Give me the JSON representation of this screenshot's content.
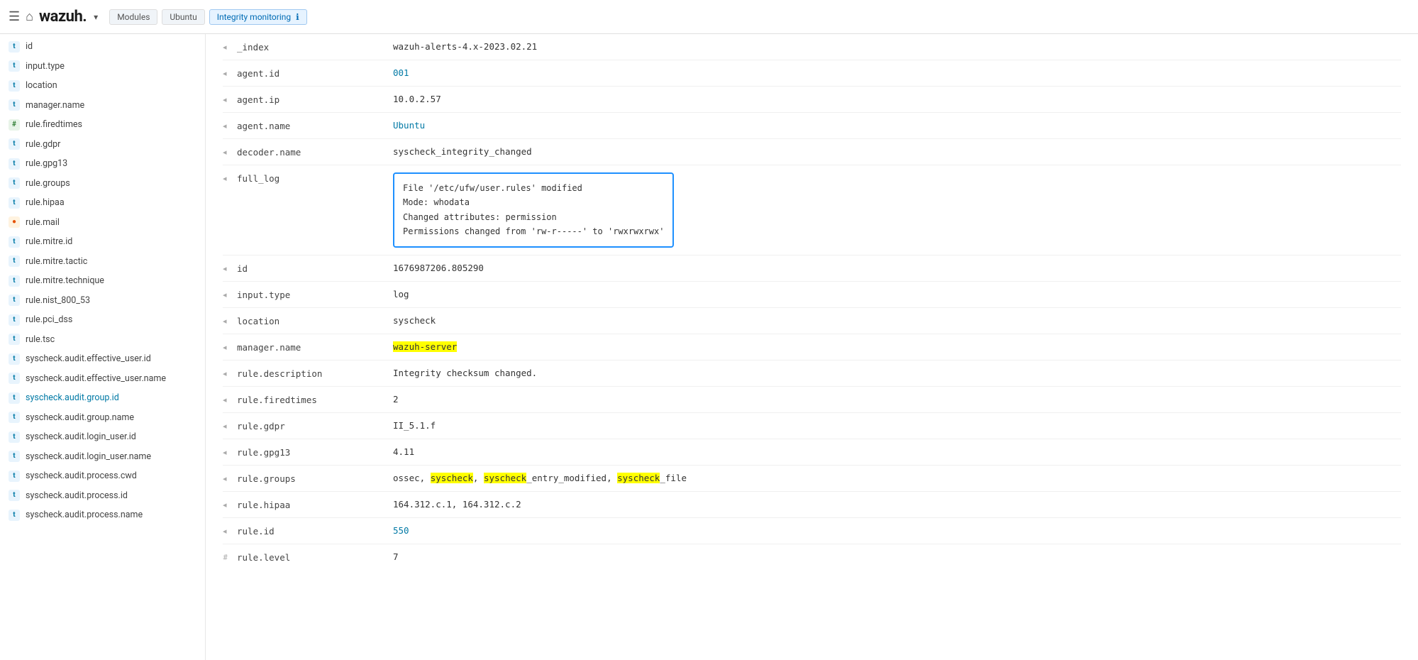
{
  "nav": {
    "hamburger": "☰",
    "home": "⌂",
    "logo_text": "wazuh.",
    "dropdown_arrow": "▾",
    "breadcrumbs": [
      {
        "label": "Modules",
        "active": false
      },
      {
        "label": "Ubuntu",
        "active": false
      },
      {
        "label": "Integrity monitoring",
        "active": true
      }
    ],
    "info_icon": "ℹ"
  },
  "sidebar": {
    "items": [
      {
        "type": "t",
        "label": "id"
      },
      {
        "type": "t",
        "label": "input.type"
      },
      {
        "type": "t",
        "label": "location"
      },
      {
        "type": "t",
        "label": "manager.name"
      },
      {
        "type": "hash",
        "label": "rule.firedtimes"
      },
      {
        "type": "t",
        "label": "rule.gdpr"
      },
      {
        "type": "t",
        "label": "rule.gpg13"
      },
      {
        "type": "t",
        "label": "rule.groups"
      },
      {
        "type": "t",
        "label": "rule.hipaa"
      },
      {
        "type": "circle",
        "label": "rule.mail"
      },
      {
        "type": "t",
        "label": "rule.mitre.id"
      },
      {
        "type": "t",
        "label": "rule.mitre.tactic"
      },
      {
        "type": "t",
        "label": "rule.mitre.technique"
      },
      {
        "type": "t",
        "label": "rule.nist_800_53"
      },
      {
        "type": "t",
        "label": "rule.pci_dss"
      },
      {
        "type": "t",
        "label": "rule.tsc"
      },
      {
        "type": "t",
        "label": "syscheck.audit.effective_user.id"
      },
      {
        "type": "t",
        "label": "syscheck.audit.effective_user.name"
      },
      {
        "type": "t",
        "label": "syscheck.audit.group.id",
        "link": true
      },
      {
        "type": "t",
        "label": "syscheck.audit.group.name"
      },
      {
        "type": "t",
        "label": "syscheck.audit.login_user.id"
      },
      {
        "type": "t",
        "label": "syscheck.audit.login_user.name"
      },
      {
        "type": "t",
        "label": "syscheck.audit.process.cwd"
      },
      {
        "type": "t",
        "label": "syscheck.audit.process.id"
      },
      {
        "type": "t",
        "label": "syscheck.audit.process.name"
      }
    ]
  },
  "content": {
    "fields": [
      {
        "toggle": "◂",
        "name": "_index",
        "value": "wazuh-alerts-4.x-2023.02.21",
        "type": "normal"
      },
      {
        "toggle": "◂",
        "name": "agent.id",
        "value": "001",
        "type": "link"
      },
      {
        "toggle": "◂",
        "name": "agent.ip",
        "value": "10.0.2.57",
        "type": "normal"
      },
      {
        "toggle": "◂",
        "name": "agent.name",
        "value": "Ubuntu",
        "type": "link"
      },
      {
        "toggle": "◂",
        "name": "decoder.name",
        "value": "syscheck_integrity_changed",
        "type": "normal"
      },
      {
        "toggle": "◂",
        "name": "full_log",
        "value": "",
        "type": "fulllog",
        "log_lines": [
          "File '/etc/ufw/user.rules' modified",
          "Mode: whodata",
          "Changed attributes: permission",
          "Permissions changed from 'rw-r-----' to 'rwxrwxrwx'"
        ]
      },
      {
        "toggle": "◂",
        "name": "id",
        "value": "1676987206.805290",
        "type": "normal"
      },
      {
        "toggle": "◂",
        "name": "input.type",
        "value": "log",
        "type": "normal"
      },
      {
        "toggle": "◂",
        "name": "location",
        "value": "syscheck",
        "type": "normal"
      },
      {
        "toggle": "◂",
        "name": "manager.name",
        "value": "wazuh-server",
        "type": "highlight-yellow"
      },
      {
        "toggle": "◂",
        "name": "rule.description",
        "value": "Integrity checksum changed.",
        "type": "normal"
      },
      {
        "toggle": "◂",
        "name": "rule.firedtimes",
        "value": "2",
        "type": "normal"
      },
      {
        "toggle": "◂",
        "name": "rule.gdpr",
        "value": "II_5.1.f",
        "type": "normal"
      },
      {
        "toggle": "◂",
        "name": "rule.gpg13",
        "value": "4.11",
        "type": "normal"
      },
      {
        "toggle": "◂",
        "name": "rule.groups",
        "value_parts": [
          {
            "text": "ossec, ",
            "highlight": false
          },
          {
            "text": "syscheck",
            "highlight": true
          },
          {
            "text": ", ",
            "highlight": false
          },
          {
            "text": "syscheck",
            "highlight": true
          },
          {
            "text": "_entry_modified, ",
            "highlight": false
          },
          {
            "text": "syscheck",
            "highlight": true
          },
          {
            "text": "_file",
            "highlight": false
          }
        ],
        "type": "groups"
      },
      {
        "toggle": "◂",
        "name": "rule.hipaa",
        "value": "164.312.c.1, 164.312.c.2",
        "type": "normal"
      },
      {
        "toggle": "◂",
        "name": "rule.id",
        "value": "550",
        "type": "link"
      },
      {
        "toggle": "#",
        "name": "rule.level",
        "value": "7",
        "type": "normal"
      }
    ]
  }
}
